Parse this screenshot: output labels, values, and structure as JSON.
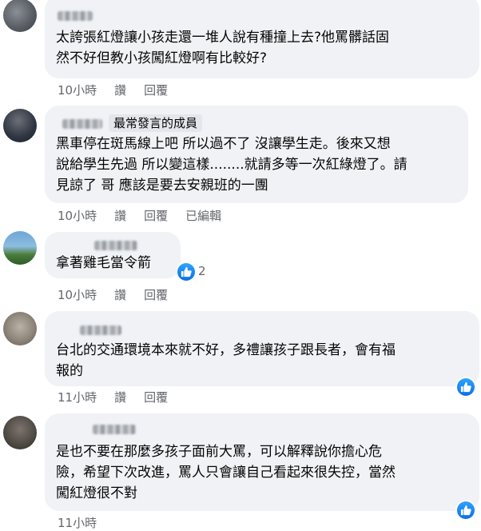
{
  "comments": [
    {
      "text": "太誇張紅燈讓小孩走還一堆人說有種撞上去?他罵髒話固然不好但教小孩闖紅燈啊有比較好?",
      "time": "10小時",
      "like": "讚",
      "reply": "回覆"
    },
    {
      "badge": "最常發言的成員",
      "text": "黑車停在斑馬線上吧 所以過不了 沒讓學生走。後來又想說給學生先過 所以變這樣........就請多等一次紅綠燈了。請見諒了 哥 應該是要去安親班的一團",
      "time": "10小時",
      "like": "讚",
      "reply": "回覆",
      "edited": "已編輯"
    },
    {
      "text": "拿著雞毛當令箭",
      "reaction_count": "2",
      "time": "10小時",
      "like": "讚",
      "reply": "回覆"
    },
    {
      "text": "台北的交通環境本來就不好，多禮讓孩子跟長者，會有福報的",
      "time": "11小時",
      "like": "讚",
      "reply": "回覆"
    },
    {
      "text": "是也不要在那麼多孩子面前大罵，可以解釋說你擔心危險，希望下次改進，罵人只會讓自己看起來很失控，當然闖紅燈很不對",
      "time": "11小時"
    }
  ],
  "lines": {
    "c1": [
      "太誇張紅燈讓小孩走還一堆人說有種撞上去?他罵髒話固",
      "然不好但教小孩闖紅燈啊有比較好?"
    ],
    "c2": [
      "黑車停在斑馬線上吧 所以過不了 沒讓學生走。後來又想",
      "說給學生先過 所以變這樣........就請多等一次紅綠燈了。請",
      "見諒了 哥 應該是要去安親班的一團"
    ],
    "c4": [
      "台北的交通環境本來就不好，多禮讓孩子跟長者，會有福",
      "報的"
    ],
    "c5": [
      "是也不要在那麼多孩子面前大罵，可以解釋說你擔心危",
      "險，希望下次改進，罵人只會讓自己看起來很失控，當然",
      "闖紅燈很不對"
    ]
  },
  "colors": {
    "bubble": "#f0f2f5",
    "meta_text": "#65676b",
    "like_blue": "#1877f2"
  },
  "icons": {
    "reaction": "like-thumb-icon"
  }
}
